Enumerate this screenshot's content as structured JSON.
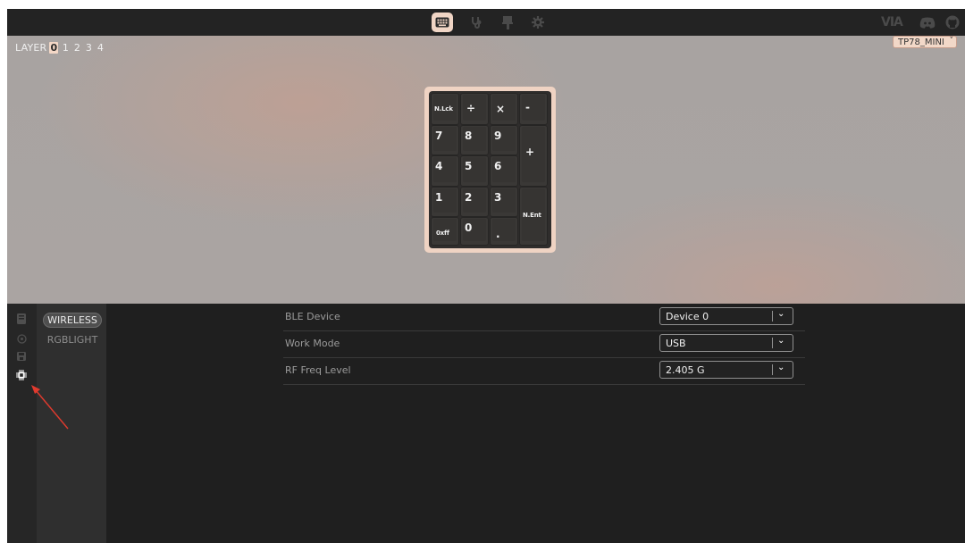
{
  "topbar": {
    "nav": [
      {
        "name": "configure",
        "icon": "keyboard-icon",
        "active": true
      },
      {
        "name": "key-tester",
        "icon": "stethoscope-icon",
        "active": false
      },
      {
        "name": "design",
        "icon": "brush-icon",
        "active": false
      },
      {
        "name": "settings",
        "icon": "gear-icon",
        "active": false
      }
    ],
    "brand": {
      "via_logo": "VIA",
      "discord_icon": "discord-icon",
      "github_icon": "github-icon"
    }
  },
  "preview": {
    "layer_label": "LAYER",
    "layers": [
      "0",
      "1",
      "2",
      "3",
      "4"
    ],
    "active_layer": "0",
    "device_select": {
      "value": "TP78_MINI"
    }
  },
  "numpad": {
    "keys": {
      "numlock": "N.Lck",
      "divide": "÷",
      "multiply": "×",
      "minus": "-",
      "k7": "7",
      "k8": "8",
      "k9": "9",
      "plus": "+",
      "k4": "4",
      "k5": "5",
      "k6": "6",
      "k1": "1",
      "k2": "2",
      "k3": "3",
      "enter": "N.Ent",
      "k00": "0xff",
      "k0": "0",
      "dot": "."
    },
    "colors": {
      "frame": "#efd3c3",
      "case": "#2f2d2c",
      "key": "#3a3836"
    }
  },
  "sidebar": {
    "icons": [
      "keyboard-icon",
      "circle-icon",
      "save-icon",
      "chip-icon"
    ],
    "active_icon": "chip-icon"
  },
  "menu": {
    "items": [
      {
        "label": "WIRELESS",
        "active": true
      },
      {
        "label": "RGBLIGHT",
        "active": false
      }
    ]
  },
  "settings": {
    "rows": [
      {
        "label": "BLE Device",
        "value": "Device 0"
      },
      {
        "label": "Work Mode",
        "value": "USB"
      },
      {
        "label": "RF Freq Level",
        "value": "2.405 G"
      }
    ]
  },
  "annotation": {
    "arrow_color": "#e03a2e",
    "arrow_icon": "red-arrow-annotation"
  }
}
